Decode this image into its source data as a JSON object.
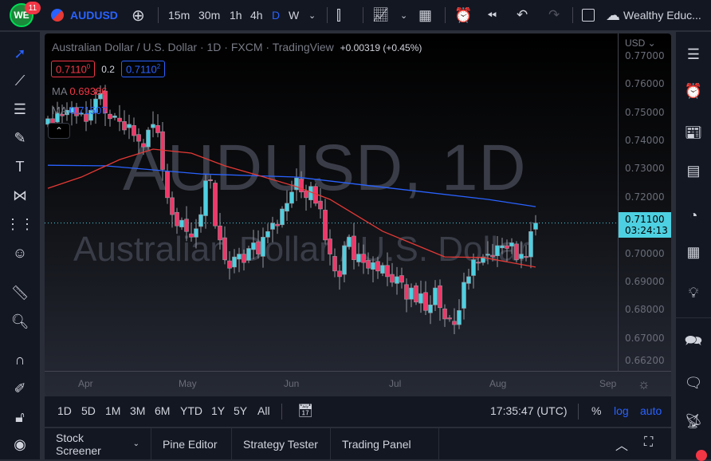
{
  "topbar": {
    "badge": "11",
    "logo": "WE",
    "symbol": "AUDUSD",
    "intervals": [
      "15m",
      "30m",
      "1h",
      "4h",
      "D",
      "W"
    ],
    "active_interval": "D",
    "account": "Wealthy Educ..."
  },
  "legend": {
    "title": "Australian Dollar / U.S. Dollar · 1D · FXCM · TradingView",
    "change": "+0.00319 (+0.45%)",
    "sell": "0.7110",
    "sell_sup": "0",
    "spread": "0.2",
    "buy": "0.7110",
    "buy_sup": "2",
    "ma1_label": "MA",
    "ma1_value": "0.69386",
    "ma2_label": "MA",
    "ma2_value": "0.71507"
  },
  "watermark": {
    "line1": "AUDUSD, 1D",
    "line2": "Australian Dollar / U.S. Dollar"
  },
  "price_axis": {
    "currency": "USD",
    "current_price": "0.71100",
    "countdown": "03:24:13"
  },
  "rangebar": {
    "ranges": [
      "1D",
      "5D",
      "1M",
      "3M",
      "6M",
      "YTD",
      "1Y",
      "5Y",
      "All"
    ],
    "clock": "17:35:47 (UTC)",
    "percent": "%",
    "log": "log",
    "auto": "auto"
  },
  "bottom_tabs": [
    "Stock Screener",
    "Pine Editor",
    "Strategy Tester",
    "Trading Panel"
  ],
  "colors": {
    "up": "#4dd0e1",
    "down": "#f23668",
    "ma_fast": "#e53935",
    "ma_slow": "#2962ff",
    "accent": "#2962ff"
  },
  "chart_data": {
    "type": "candlestick",
    "title": "AUDUSD, 1D",
    "ylim": [
      0.662,
      0.77
    ],
    "y_ticks": [
      "0.77000",
      "0.76000",
      "0.75000",
      "0.74000",
      "0.73000",
      "0.72000",
      "0.70000",
      "0.69000",
      "0.68000",
      "0.67000",
      "0.66200"
    ],
    "x_ticks": [
      {
        "label": "Apr",
        "index": 8
      },
      {
        "label": "May",
        "index": 29
      },
      {
        "label": "Jun",
        "index": 51
      },
      {
        "label": "Jul",
        "index": 73
      },
      {
        "label": "Aug",
        "index": 94
      },
      {
        "label": "Sep",
        "index": 117
      }
    ],
    "closes": [
      0.748,
      0.746,
      0.75,
      0.749,
      0.751,
      0.752,
      0.749,
      0.75,
      0.747,
      0.751,
      0.755,
      0.757,
      0.75,
      0.748,
      0.749,
      0.747,
      0.744,
      0.746,
      0.742,
      0.74,
      0.738,
      0.744,
      0.746,
      0.743,
      0.73,
      0.72,
      0.714,
      0.71,
      0.712,
      0.708,
      0.706,
      0.709,
      0.714,
      0.726,
      0.726,
      0.71,
      0.705,
      0.698,
      0.695,
      0.699,
      0.7,
      0.697,
      0.702,
      0.704,
      0.7,
      0.706,
      0.708,
      0.711,
      0.71,
      0.716,
      0.718,
      0.722,
      0.727,
      0.722,
      0.72,
      0.724,
      0.718,
      0.716,
      0.705,
      0.7,
      0.694,
      0.692,
      0.703,
      0.706,
      0.698,
      0.7,
      0.697,
      0.695,
      0.697,
      0.694,
      0.696,
      0.692,
      0.69,
      0.692,
      0.69,
      0.684,
      0.688,
      0.683,
      0.686,
      0.68,
      0.682,
      0.688,
      0.681,
      0.677,
      0.677,
      0.675,
      0.68,
      0.69,
      0.692,
      0.698,
      0.697,
      0.699,
      0.7,
      0.699,
      0.703,
      0.703,
      0.702,
      0.704,
      0.698,
      0.7,
      0.699,
      0.708,
      0.711
    ],
    "ma_fast": [
      [
        0,
        0.7233
      ],
      [
        7,
        0.7273
      ],
      [
        15,
        0.7335
      ],
      [
        22,
        0.7372
      ],
      [
        30,
        0.7358
      ],
      [
        37,
        0.7313
      ],
      [
        44,
        0.7279
      ],
      [
        52,
        0.7239
      ],
      [
        59,
        0.7194
      ],
      [
        70,
        0.7081
      ],
      [
        83,
        0.699
      ],
      [
        91,
        0.6988
      ],
      [
        102,
        0.6954
      ]
    ],
    "ma_slow": [
      [
        0,
        0.7315
      ],
      [
        12,
        0.7313
      ],
      [
        32,
        0.7284
      ],
      [
        52,
        0.7273
      ],
      [
        66,
        0.7245
      ],
      [
        92,
        0.7194
      ],
      [
        102,
        0.7168
      ]
    ],
    "current_price": 0.711
  }
}
